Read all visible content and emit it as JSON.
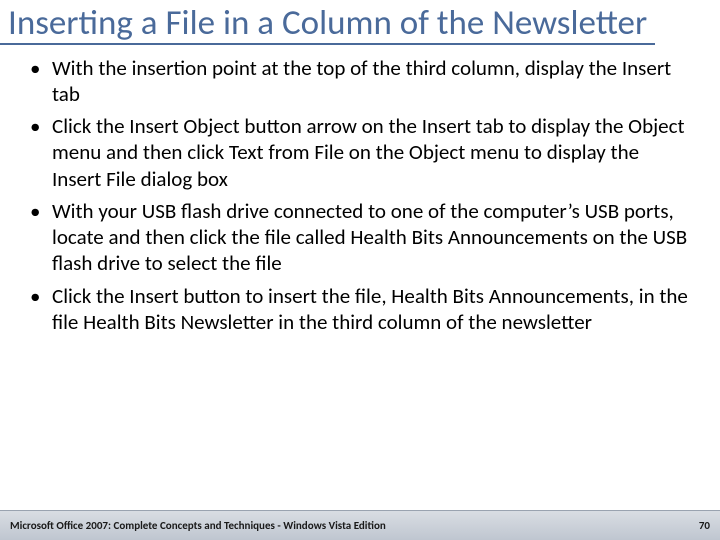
{
  "title": "Inserting a File in a Column of the Newsletter",
  "bullets": [
    "With the insertion point at the top of the third column, display the Insert tab",
    "Click the Insert Object button arrow on the Insert tab to display the Object menu and then click Text from File on the Object menu to display the Insert File dialog box",
    "With your USB flash drive connected to one of the computer’s USB ports, locate and then click the file called Health Bits Announcements on the USB flash drive to select the file",
    "Click the Insert button to insert the file, Health Bits Announcements, in the file Health Bits Newsletter in the third column of the newsletter"
  ],
  "footer": {
    "left": "Microsoft Office 2007: Complete Concepts and Techniques - Windows Vista Edition",
    "page": "70"
  }
}
